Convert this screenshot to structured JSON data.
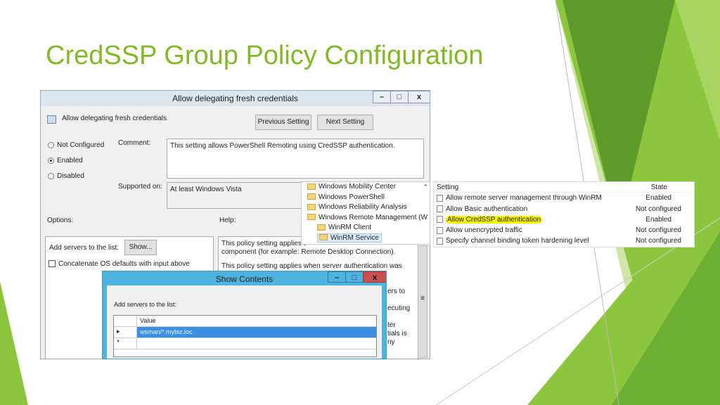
{
  "slide": {
    "title": "CredSSP Group Policy Configuration",
    "accent": "#84b82b"
  },
  "dialog": {
    "title": "Allow delegating fresh credentials",
    "setting_name": "Allow delegating fresh credentials",
    "prev": "Previous Setting",
    "next": "Next Setting",
    "minimize": "–",
    "maximize": "□",
    "close": "x",
    "radios": [
      {
        "label": "Not Configured",
        "selected": false
      },
      {
        "label": "Enabled",
        "selected": true
      },
      {
        "label": "Disabled",
        "selected": false
      }
    ],
    "comment_label": "Comment:",
    "comment": "This setting allows PowerShell Remoting using CredSSP authentication.",
    "supported_label": "Supported on:",
    "supported": "At least Windows Vista",
    "options_label": "Options:",
    "help_label": "Help:",
    "add_servers": "Add servers to the list:",
    "show": "Show...",
    "concat": "Concatenate OS defaults with input above",
    "help_lines": [
      "This policy setting applies t",
      "component (for example: Remote Desktop Connection).",
      "This policy setting applies when server authentication was"
    ],
    "help_frag": [
      "ers to",
      "",
      "ecuting",
      "",
      "ter",
      "tials is",
      "ny"
    ]
  },
  "tree": {
    "items": [
      "Windows Mobility Center",
      "Windows PowerShell",
      "Windows Reliability Analysis",
      "Windows Remote Management (W",
      "WinRM Client",
      "WinRM Service"
    ]
  },
  "settings": {
    "col_setting": "Setting",
    "col_state": "State",
    "rows": [
      {
        "name": "Allow remote server management through WinRM",
        "state": "Enabled"
      },
      {
        "name": "Allow Basic authentication",
        "state": "Not configured"
      },
      {
        "name": "Allow CredSSP authentication",
        "state": "Enabled"
      },
      {
        "name": "Allow unencrypted traffic",
        "state": "Not configured"
      },
      {
        "name": "Specify channel binding token hardening level",
        "state": "Not configured"
      }
    ]
  },
  "show_contents": {
    "title": "Show Contents",
    "label": "Add servers to the list:",
    "col": "Value",
    "value": "wsman/*.mybiz.loc",
    "new_row": "*",
    "cur_row": "▸"
  }
}
